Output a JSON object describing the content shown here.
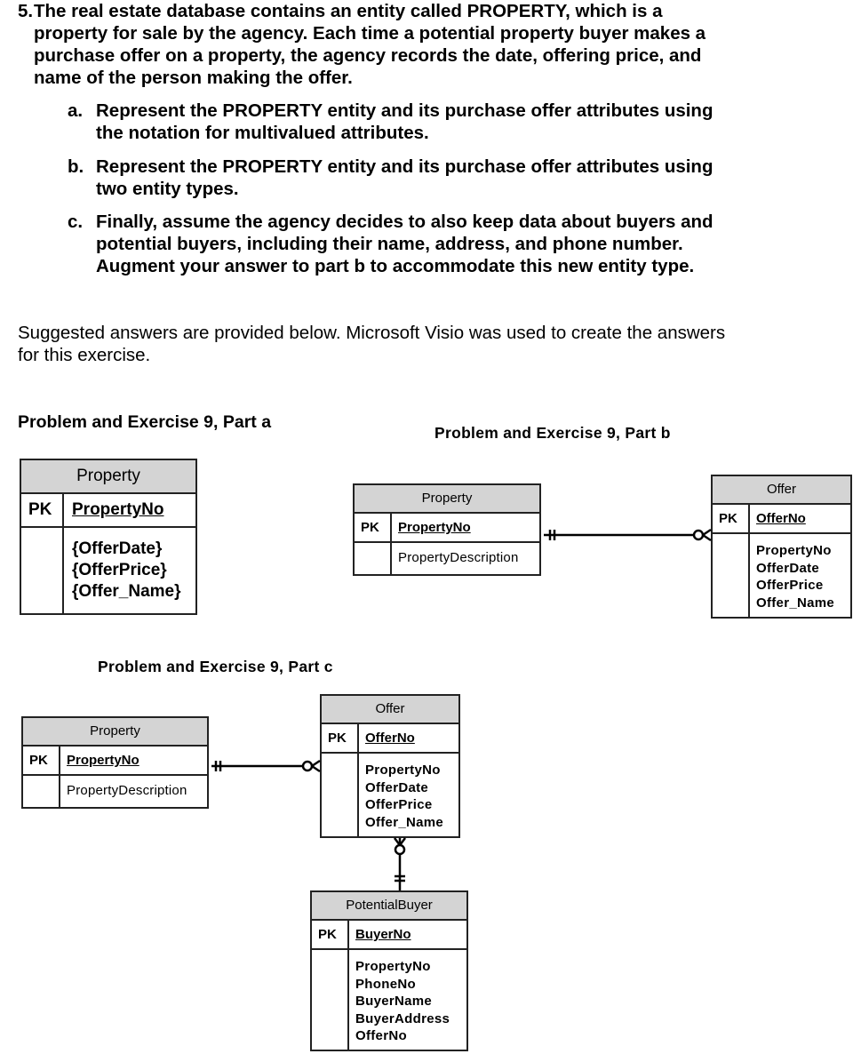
{
  "question": {
    "number": "5.",
    "text": "The  real estate database contains an entity called PROPERTY, which is a property for sale by the agency.  Each time a potential property buyer makes a purchase offer on a property, the agency records the date, offering price, and name of the person making the offer.",
    "lines": [
      "The  real estate database contains an entity called PROPERTY, which is a",
      "property for sale by the agency.  Each time a potential property buyer makes a",
      "purchase offer on a property, the agency records the date, offering price, and",
      "name of the person making the offer."
    ],
    "parts": [
      {
        "label": "a.",
        "lines": [
          "Represent the PROPERTY entity and its purchase offer attributes using",
          "the notation for multivalued attributes."
        ]
      },
      {
        "label": "b.",
        "lines": [
          "Represent the PROPERTY entity and its purchase offer attributes using",
          "two entity types."
        ]
      },
      {
        "label": "c.",
        "lines": [
          "Finally, assume the agency decides to also keep data about buyers and",
          "potential buyers, including their name, address, and phone number.",
          "Augment your answer to part b to accommodate this new entity type."
        ]
      }
    ]
  },
  "note": {
    "lines": [
      "Suggested answers are provided below.  Microsoft Visio was used to create the answers",
      "for this exercise."
    ]
  },
  "sections": {
    "part_a": "Problem and Exercise 9, Part a",
    "part_b": "Problem and Exercise 9, Part b",
    "part_c": "Problem and Exercise 9, Part c"
  },
  "diagrams": {
    "part_a": {
      "property": {
        "title": "Property",
        "pk_label": "PK",
        "pk": "PropertyNo",
        "attributes": [
          "{OfferDate}",
          "{OfferPrice}",
          "{Offer_Name}"
        ]
      }
    },
    "part_b": {
      "property": {
        "title": "Property",
        "pk_label": "PK",
        "pk": "PropertyNo",
        "attributes": [
          "PropertyDescription"
        ]
      },
      "offer": {
        "title": "Offer",
        "pk_label": "PK",
        "pk": "OfferNo",
        "attributes": [
          "PropertyNo",
          "OfferDate",
          "OfferPrice",
          "Offer_Name"
        ]
      },
      "relationship": {
        "from": "Property",
        "to": "Offer",
        "from_cardinality": "one-and-only-one",
        "to_cardinality": "zero-or-many"
      }
    },
    "part_c": {
      "property": {
        "title": "Property",
        "pk_label": "PK",
        "pk": "PropertyNo",
        "attributes": [
          "PropertyDescription"
        ]
      },
      "offer": {
        "title": "Offer",
        "pk_label": "PK",
        "pk": "OfferNo",
        "attributes": [
          "PropertyNo",
          "OfferDate",
          "OfferPrice",
          "Offer_Name"
        ]
      },
      "buyer": {
        "title": "PotentialBuyer",
        "pk_label": "PK",
        "pk": "BuyerNo",
        "attributes": [
          "PropertyNo",
          "PhoneNo",
          "BuyerName",
          "BuyerAddress",
          "OfferNo"
        ]
      },
      "relationships": [
        {
          "from": "Property",
          "to": "Offer",
          "from_cardinality": "one-and-only-one",
          "to_cardinality": "zero-or-many"
        },
        {
          "from": "PotentialBuyer",
          "to": "Offer",
          "from_cardinality": "one-and-only-one",
          "to_cardinality": "zero-or-many"
        }
      ]
    }
  }
}
